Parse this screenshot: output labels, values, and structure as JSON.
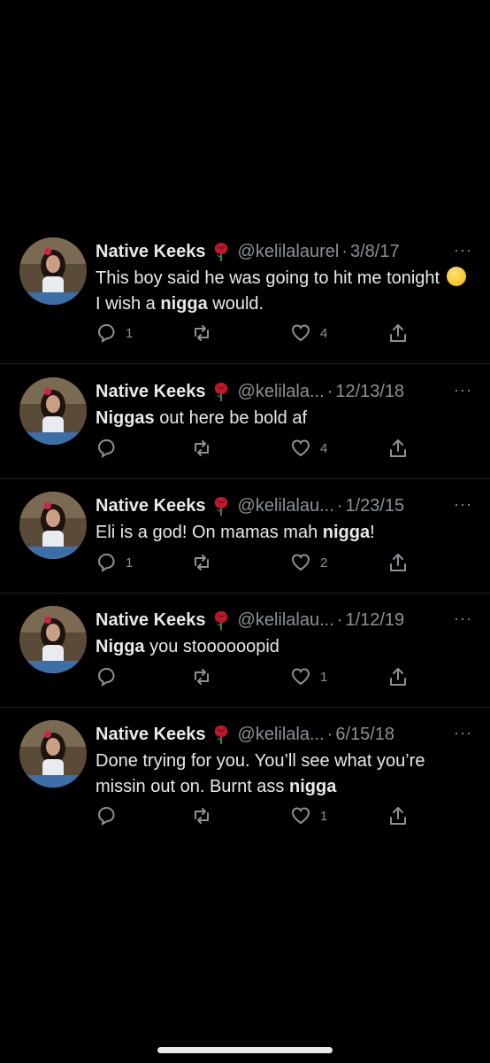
{
  "author": {
    "name": "Native Keeks",
    "icon": "rose-emoji"
  },
  "tweets": [
    {
      "handle": "@kelilalaurel",
      "date": "3/8/17",
      "text_parts": [
        "This boy said he was going to hit me tonight ",
        " I wish a ",
        "nigga",
        " would."
      ],
      "replies": "1",
      "retweets": "",
      "likes": "4"
    },
    {
      "handle": "@kelilala...",
      "date": "12/13/18",
      "text_parts": [
        "Niggas",
        " out here be bold af"
      ],
      "replies": "",
      "retweets": "",
      "likes": "4"
    },
    {
      "handle": "@kelilalau...",
      "date": "1/23/15",
      "text_parts": [
        "Eli is a god! On mamas mah ",
        "nigga",
        "!"
      ],
      "replies": "1",
      "retweets": "",
      "likes": "2"
    },
    {
      "handle": "@kelilalau...",
      "date": "1/12/19",
      "text_parts": [
        "Nigga",
        " you stoooooopid"
      ],
      "replies": "",
      "retweets": "",
      "likes": "1"
    },
    {
      "handle": "@kelilala...",
      "date": "6/15/18",
      "text_parts": [
        "Done trying for you. You’ll see what you’re missin out on. Burnt ass ",
        "nigga"
      ],
      "replies": "",
      "retweets": "",
      "likes": "1"
    }
  ],
  "ui": {
    "separator": "·",
    "more": "···"
  },
  "colors": {
    "background": "#000000",
    "text": "#e7e9ea",
    "muted": "#8b9197",
    "rose": "#c0182a"
  }
}
